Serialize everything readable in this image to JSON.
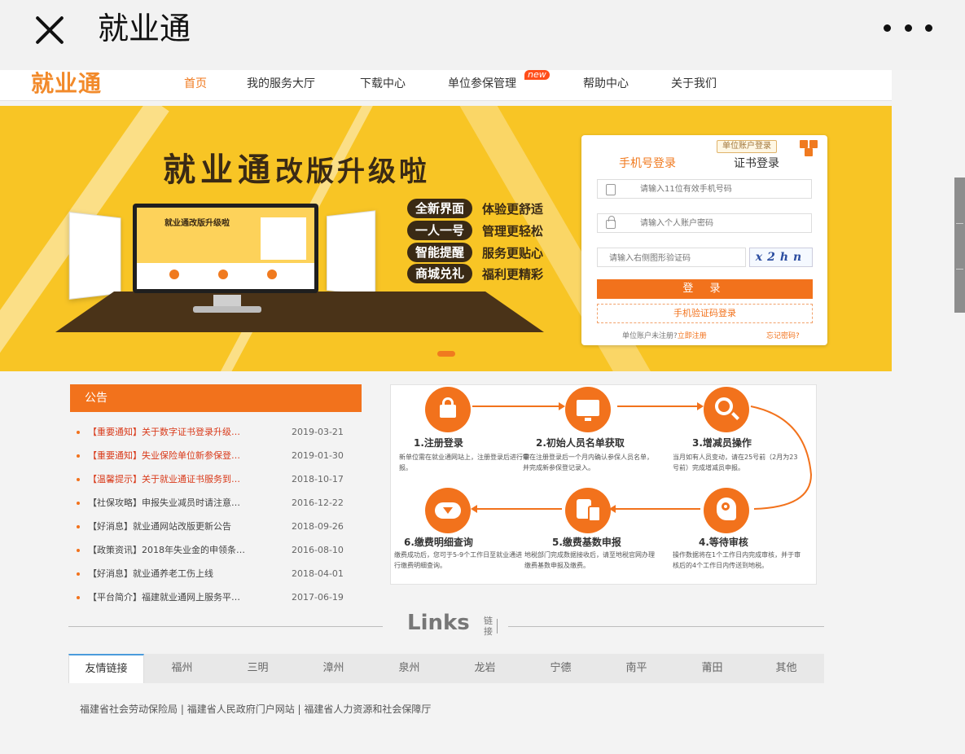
{
  "titlebar": {
    "title": "就业通"
  },
  "nav": {
    "logo": "就业通",
    "items": [
      "首页",
      "我的服务大厅",
      "下载中心",
      "单位参保管理",
      "帮助中心",
      "关于我们"
    ],
    "badge": "new"
  },
  "banner": {
    "title_main": "就业通",
    "title_sub": "改版升级啦",
    "monitor_title": "就业通改版升级啦",
    "features": [
      {
        "pill": "全新界面",
        "text": "体验更舒适"
      },
      {
        "pill": "一人一号",
        "text": "管理更轻松"
      },
      {
        "pill": "智能提醒",
        "text": "服务更贴心"
      },
      {
        "pill": "商城兑礼",
        "text": "福利更精彩"
      }
    ]
  },
  "login": {
    "unit_tag": "单位账户登录",
    "tab_phone": "手机号登录",
    "tab_cert": "证书登录",
    "phone_placeholder": "请输入11位有效手机号码",
    "password_placeholder": "请输入个人账户密码",
    "captcha_placeholder": "请输入右侧图形验证码",
    "captcha_text": "x2hn",
    "login_button": "登 录",
    "sms_button": "手机验证码登录",
    "unregistered": "单位账户未注册?",
    "register_link": "立即注册",
    "forgot": "忘记密码?"
  },
  "notices": {
    "header": "公告",
    "items": [
      {
        "title": "【重要通知】关于数字证书登录升级…",
        "date": "2019-03-21",
        "color": "red"
      },
      {
        "title": "【重要通知】失业保险单位新参保登…",
        "date": "2019-01-30",
        "color": "red"
      },
      {
        "title": "【温馨提示】关于就业通证书服务到…",
        "date": "2018-10-17",
        "color": "red"
      },
      {
        "title": "【社保攻略】申报失业减员时请注意…",
        "date": "2016-12-22",
        "color": "dark"
      },
      {
        "title": "【好消息】就业通网站改版更新公告",
        "date": "2018-09-26",
        "color": "dark"
      },
      {
        "title": "【政策资讯】2018年失业金的申领条…",
        "date": "2016-08-10",
        "color": "dark"
      },
      {
        "title": "【好消息】就业通养老工伤上线",
        "date": "2018-04-01",
        "color": "dark"
      },
      {
        "title": "【平台简介】福建就业通网上服务平…",
        "date": "2017-06-19",
        "color": "dark"
      }
    ]
  },
  "process": {
    "steps": [
      {
        "title": "1.注册登录",
        "desc": "新单位需在就业通网站上，注册登录后进行申报。"
      },
      {
        "title": "2.初始人员名单获取",
        "desc": "需在注册登录后一个月内确认参保人员名单，并完成新参保登记录入。"
      },
      {
        "title": "3.增减员操作",
        "desc": "当月如有人员变动，请在25号前（2月为23号前）完成增减员申报。"
      },
      {
        "title": "4.等待审核",
        "desc": "操作数据将在1个工作日内完成审核，并于审核后的4个工作日内传送到地税。"
      },
      {
        "title": "5.缴费基数申报",
        "desc": "地税部门完成数据接收后，请至地税官网办理缴费基数申报及缴费。"
      },
      {
        "title": "6.缴费明细查询",
        "desc": "缴费成功后，您可于5-9个工作日至就业通进行缴费明细查询。"
      }
    ]
  },
  "links": {
    "title": "Links",
    "cn": "链接",
    "tabs": [
      "友情链接",
      "福州",
      "三明",
      "漳州",
      "泉州",
      "龙岩",
      "宁德",
      "南平",
      "莆田",
      "其他"
    ],
    "row": [
      "福建省社会劳动保险局",
      "福建省人民政府门户网站",
      "福建省人力资源和社会保障厅"
    ],
    "separator": " | "
  },
  "colors": {
    "accent": "#f2721c",
    "banner": "#f8c525",
    "dark": "#3a2a15"
  }
}
